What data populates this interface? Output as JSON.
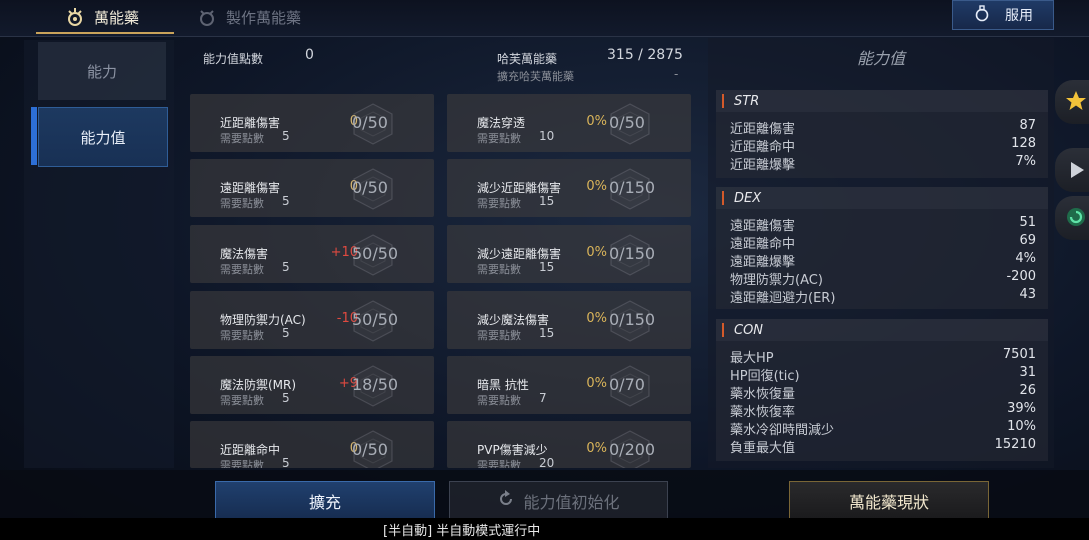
{
  "tabs": {
    "active_label": "萬能藥",
    "inactive_label": "製作萬能藥"
  },
  "use_button": {
    "label": "服用"
  },
  "left_menu": [
    {
      "label": "能力"
    },
    {
      "label": "能力值"
    }
  ],
  "header": {
    "points_label": "能力值點數",
    "points_value": "0",
    "potion_label": "哈芙萬能藥",
    "potion_value": "315 / 2875",
    "expand_label": "擴充哈芙萬能藥",
    "expand_value": "-"
  },
  "cards": [
    {
      "name": "近距離傷害",
      "req_label": "需要點數",
      "req": "5",
      "bonus": "0",
      "level": "0/50"
    },
    {
      "name": "魔法穿透",
      "req_label": "需要點數",
      "req": "10",
      "bonus": "0%",
      "level": "0/50"
    },
    {
      "name": "遠距離傷害",
      "req_label": "需要點數",
      "req": "5",
      "bonus": "0",
      "level": "0/50"
    },
    {
      "name": "減少近距離傷害",
      "req_label": "需要點數",
      "req": "15",
      "bonus": "0%",
      "level": "0/150"
    },
    {
      "name": "魔法傷害",
      "req_label": "需要點數",
      "req": "5",
      "bonus": "+10",
      "level": "50/50"
    },
    {
      "name": "減少遠距離傷害",
      "req_label": "需要點數",
      "req": "15",
      "bonus": "0%",
      "level": "0/150"
    },
    {
      "name": "物理防禦力(AC)",
      "req_label": "需要點數",
      "req": "5",
      "bonus": "-10",
      "level": "50/50"
    },
    {
      "name": "減少魔法傷害",
      "req_label": "需要點數",
      "req": "15",
      "bonus": "0%",
      "level": "0/150"
    },
    {
      "name": "魔法防禦(MR)",
      "req_label": "需要點數",
      "req": "5",
      "bonus": "+9",
      "level": "18/50"
    },
    {
      "name": "暗黑 抗性",
      "req_label": "需要點數",
      "req": "7",
      "bonus": "0%",
      "level": "0/70"
    },
    {
      "name": "近距離命中",
      "req_label": "需要點數",
      "req": "5",
      "bonus": "0",
      "level": "0/50"
    },
    {
      "name": "PVP傷害減少",
      "req_label": "需要點數",
      "req": "20",
      "bonus": "0%",
      "level": "0/200"
    }
  ],
  "stats_panel": {
    "title": "能力值",
    "sections": [
      {
        "name": "STR",
        "rows": [
          {
            "label": "近距離傷害",
            "value": "87"
          },
          {
            "label": "近距離命中",
            "value": "128"
          },
          {
            "label": "近距離爆擊",
            "value": "7%"
          }
        ]
      },
      {
        "name": "DEX",
        "rows": [
          {
            "label": "遠距離傷害",
            "value": "51"
          },
          {
            "label": "遠距離命中",
            "value": "69"
          },
          {
            "label": "遠距離爆擊",
            "value": "4%"
          },
          {
            "label": "物理防禦力(AC)",
            "value": "-200"
          },
          {
            "label": "遠距離迴避力(ER)",
            "value": "43"
          }
        ]
      },
      {
        "name": "CON",
        "rows": [
          {
            "label": "最大HP",
            "value": "7501"
          },
          {
            "label": "HP回復(tic)",
            "value": "31"
          },
          {
            "label": "藥水恢復量",
            "value": "26"
          },
          {
            "label": "藥水恢復率",
            "value": "39%"
          },
          {
            "label": "藥水冷卻時間減少",
            "value": "10%"
          },
          {
            "label": "負重最大值",
            "value": "15210"
          }
        ]
      }
    ]
  },
  "buttons": {
    "expand": "擴充",
    "reset": "能力值初始化",
    "status": "萬能藥現狀"
  },
  "auto_mode": "[半自動] 半自動模式運行中",
  "colors": {
    "accent_blue": "#2d6fd6",
    "bonus_red": "#e04a40",
    "bonus_gold": "#d9b45a",
    "stat_bar": "#d45a2a"
  }
}
